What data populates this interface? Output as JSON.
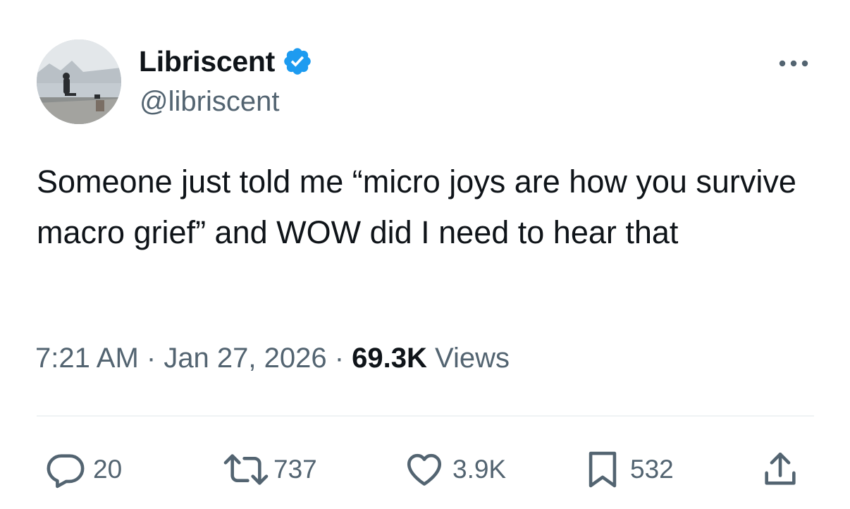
{
  "author": {
    "display_name": "Libriscent",
    "handle": "@libriscent",
    "verified": true,
    "verified_color": "#1d9bf0"
  },
  "tweet": {
    "text": "Someone just told me “micro joys are how you survive macro grief” and WOW did I need to hear that",
    "time": "7:21 AM",
    "date": "Jan 27, 2026",
    "separator": " · ",
    "views_count": "69.3K",
    "views_label": "Views"
  },
  "actions": {
    "replies": "20",
    "reposts": "737",
    "likes": "3.9K",
    "bookmarks": "532"
  },
  "icons": {
    "reply": "reply-icon",
    "repost": "repost-icon",
    "like": "heart-icon",
    "bookmark": "bookmark-icon",
    "share": "share-icon",
    "more": "more-icon",
    "verified": "verified-badge-icon"
  },
  "colors": {
    "text_primary": "#0f1419",
    "text_secondary": "#536471",
    "divider": "#eff3f4"
  }
}
